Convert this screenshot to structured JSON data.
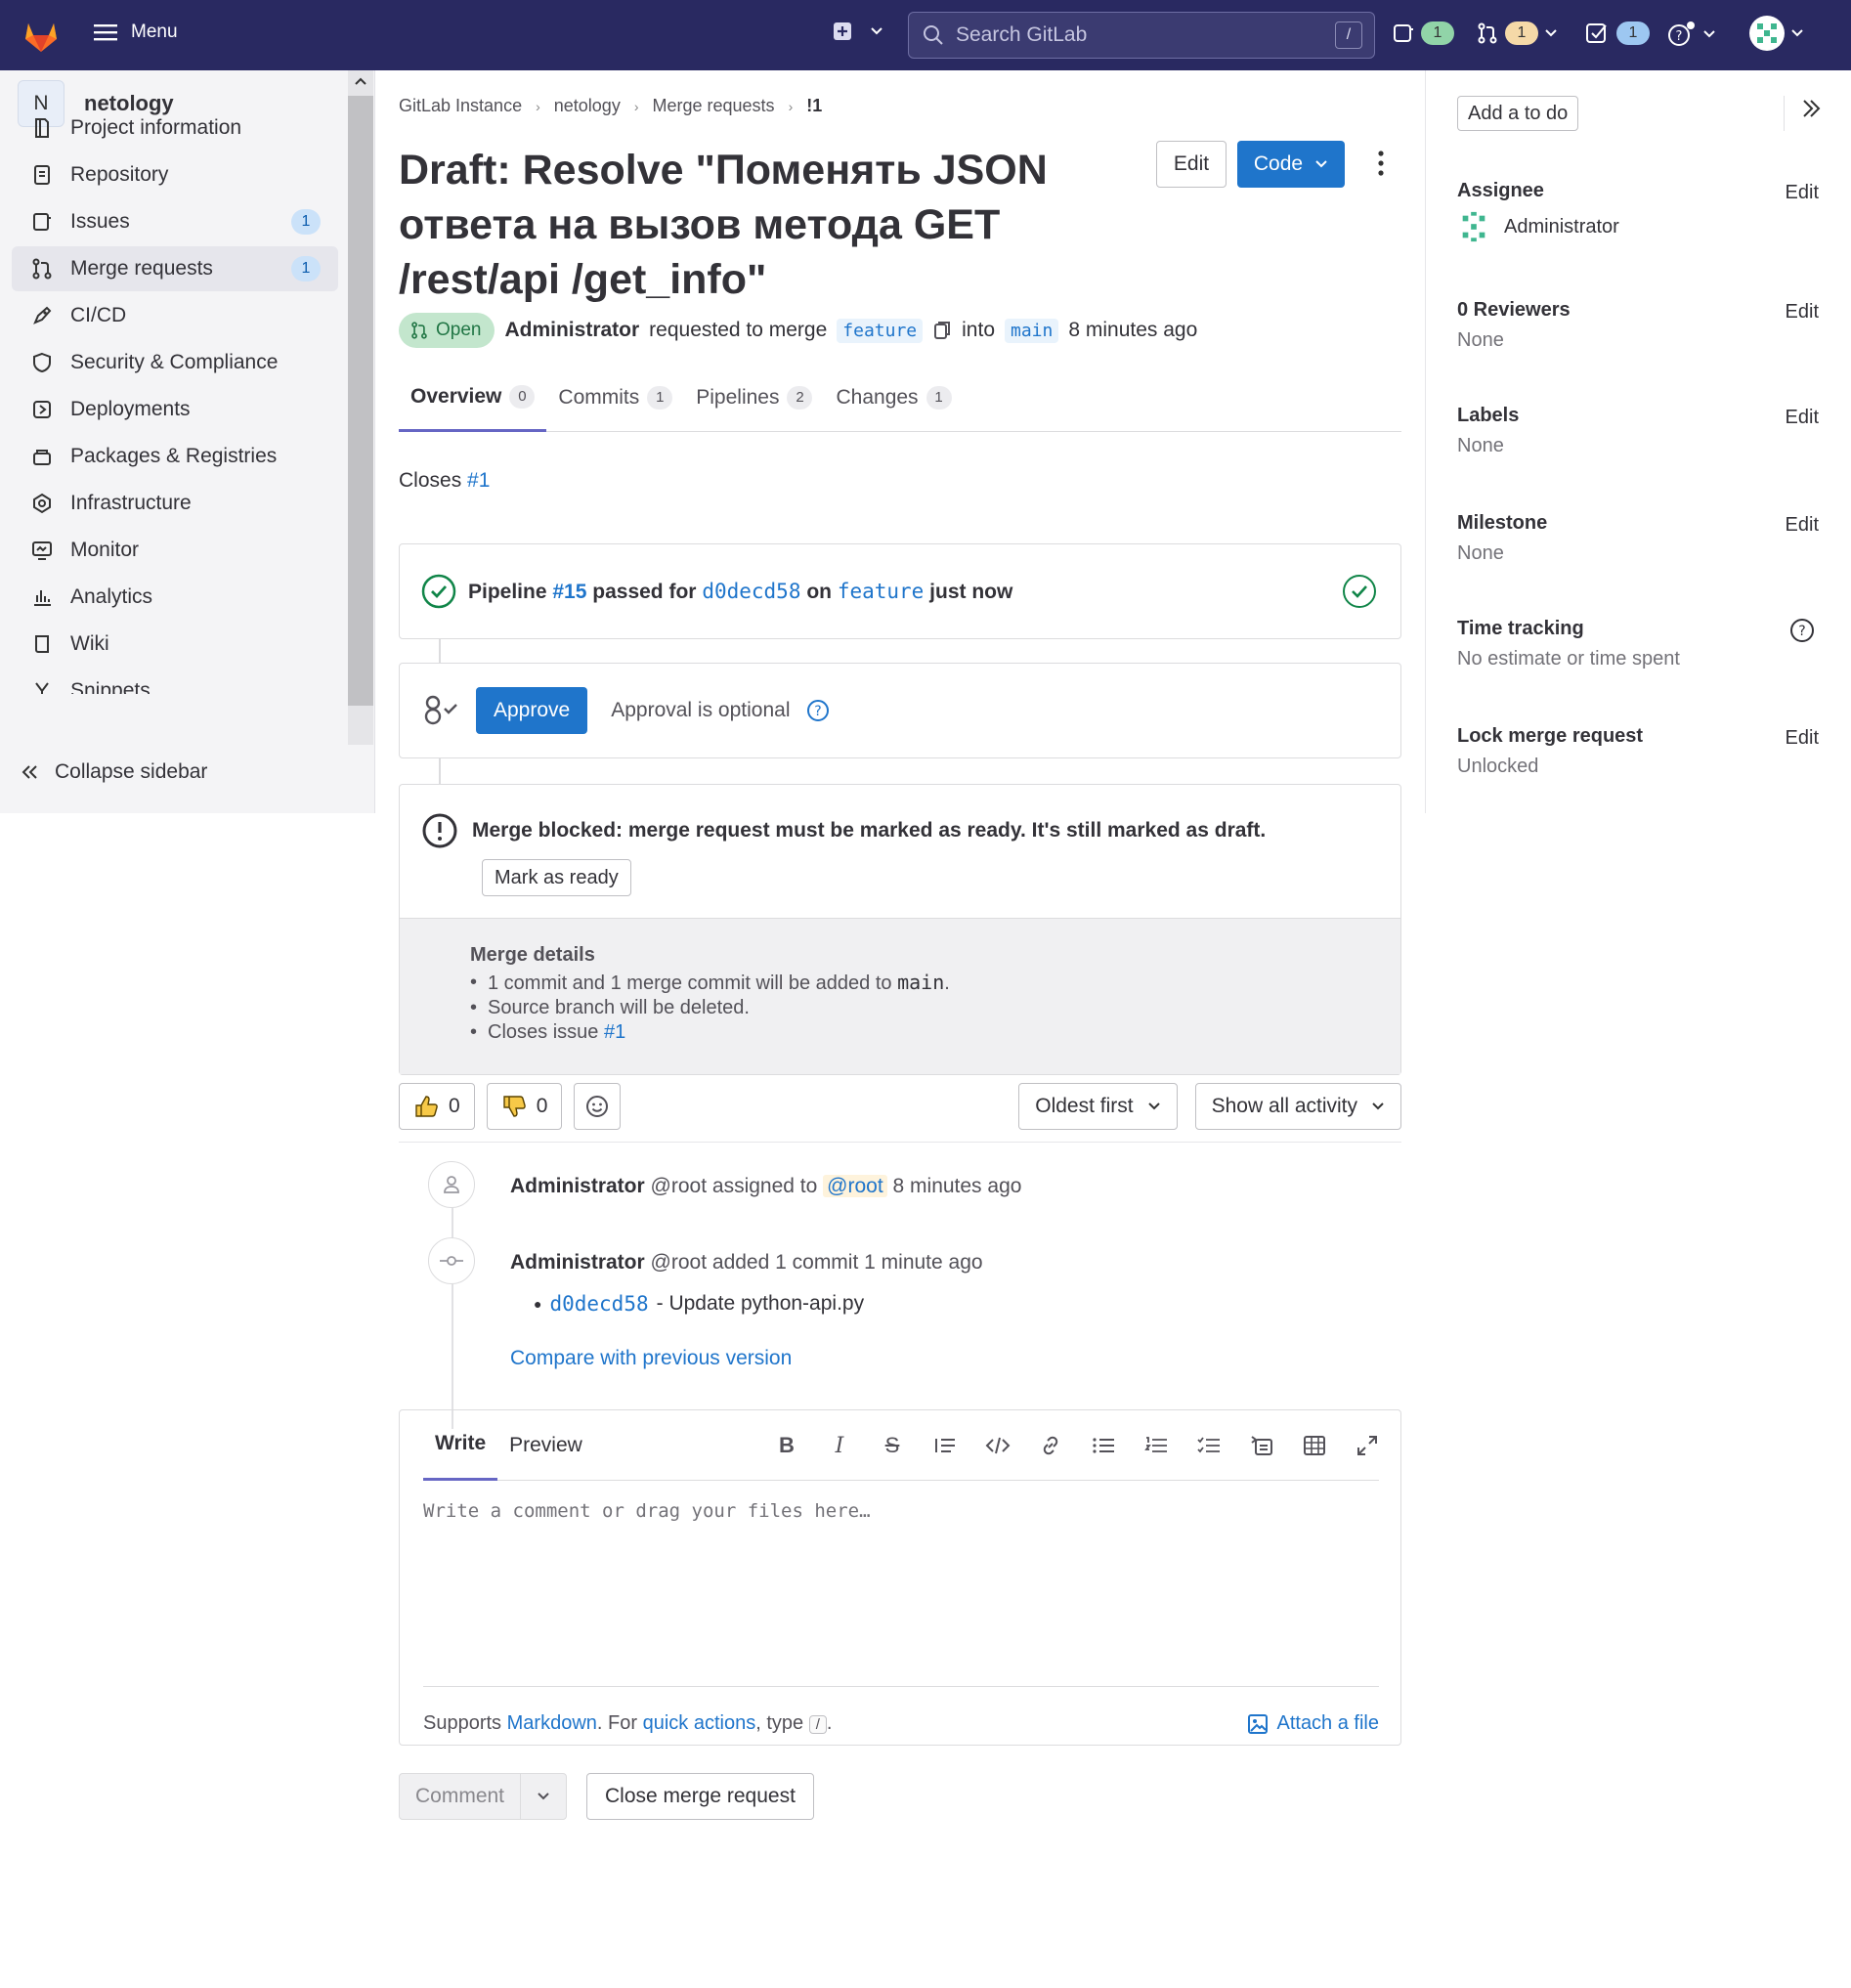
{
  "topbar": {
    "menu_label": "Menu",
    "search_placeholder": "Search GitLab",
    "search_shortcut": "/",
    "issues_count": "1",
    "mr_count": "1",
    "todos_count": "1"
  },
  "sidebar": {
    "project_initial": "N",
    "project_name": "netology",
    "items": [
      {
        "label": "Project information",
        "icon": "project-info-icon"
      },
      {
        "label": "Repository",
        "icon": "repository-icon"
      },
      {
        "label": "Issues",
        "icon": "issues-icon",
        "count": "1"
      },
      {
        "label": "Merge requests",
        "icon": "merge-request-icon",
        "count": "1"
      },
      {
        "label": "CI/CD",
        "icon": "rocket-icon"
      },
      {
        "label": "Security & Compliance",
        "icon": "shield-icon"
      },
      {
        "label": "Deployments",
        "icon": "deployments-icon"
      },
      {
        "label": "Packages & Registries",
        "icon": "package-icon"
      },
      {
        "label": "Infrastructure",
        "icon": "cloud-gear-icon"
      },
      {
        "label": "Monitor",
        "icon": "monitor-icon"
      },
      {
        "label": "Analytics",
        "icon": "chart-icon"
      },
      {
        "label": "Wiki",
        "icon": "book-icon"
      },
      {
        "label": "Snippets",
        "icon": "snippet-icon"
      }
    ],
    "collapse_label": "Collapse sidebar"
  },
  "breadcrumb": [
    "GitLab Instance",
    "netology",
    "Merge requests",
    "!1"
  ],
  "mr": {
    "title": "Draft: Resolve \"Поменять JSON ответа на вызов метода GET /rest/api /get_info\"",
    "edit_label": "Edit",
    "code_label": "Code",
    "status": "Open",
    "author": "Administrator",
    "requested_text": "requested to merge",
    "source_branch": "feature",
    "into_text": "into",
    "target_branch": "main",
    "time": "8 minutes ago"
  },
  "tabs": [
    {
      "label": "Overview",
      "count": "0"
    },
    {
      "label": "Commits",
      "count": "1"
    },
    {
      "label": "Pipelines",
      "count": "2"
    },
    {
      "label": "Changes",
      "count": "1"
    }
  ],
  "closes": {
    "text": "Closes",
    "issue": "#1"
  },
  "pipeline": {
    "word": "Pipeline",
    "id": "#15",
    "passed_for": "passed for",
    "commit": "d0decd58",
    "on": "on",
    "branch": "feature",
    "when": "just now",
    "status_color": "#108548"
  },
  "approval": {
    "approve_label": "Approve",
    "optional_text": "Approval is optional"
  },
  "merge_block": {
    "message": "Merge blocked: merge request must be marked as ready. It's still marked as draft.",
    "ready_label": "Mark as ready",
    "details_title": "Merge details",
    "detail_1_pre": "1 commit and 1 merge commit will be added to",
    "detail_1_branch": "main",
    "detail_1_post": ".",
    "detail_2": "Source branch will be deleted.",
    "detail_3_pre": "Closes issue",
    "detail_3_issue": "#1"
  },
  "reactions": {
    "thumbs_up": "0",
    "thumbs_down": "0"
  },
  "sort": {
    "order": "Oldest first",
    "filter": "Show all activity"
  },
  "activity": [
    {
      "author": "Administrator",
      "handle": "@root",
      "action": "assigned to",
      "mention": "@root",
      "time": "8 minutes ago"
    },
    {
      "author": "Administrator",
      "handle": "@root",
      "action": "added 1 commit",
      "time": "1 minute ago"
    }
  ],
  "commit_item": {
    "sha": "d0decd58",
    "message": "- Update python-api.py"
  },
  "compare_label": "Compare with previous version",
  "editor": {
    "write_tab": "Write",
    "preview_tab": "Preview",
    "placeholder": "Write a comment or drag your files here…",
    "supports": "Supports",
    "markdown": "Markdown",
    "for_text": ". For",
    "quick_actions": "quick actions",
    "type_text": ", type",
    "slash": "/",
    "period": ".",
    "attach": "Attach a file"
  },
  "actions": {
    "comment_label": "Comment",
    "close_label": "Close merge request"
  },
  "right_sidebar": {
    "todo_label": "Add a to do",
    "assignee_title": "Assignee",
    "assignee_name": "Administrator",
    "reviewers_title": "0 Reviewers",
    "reviewers_value": "None",
    "labels_title": "Labels",
    "labels_value": "None",
    "milestone_title": "Milestone",
    "milestone_value": "None",
    "time_title": "Time tracking",
    "time_value": "No estimate or time spent",
    "lock_title": "Lock merge request",
    "lock_value": "Unlocked",
    "edit_label": "Edit"
  },
  "colors": {
    "topbar": "#292961",
    "accent": "#1f75cb",
    "success": "#108548",
    "brand": "#e24329"
  }
}
